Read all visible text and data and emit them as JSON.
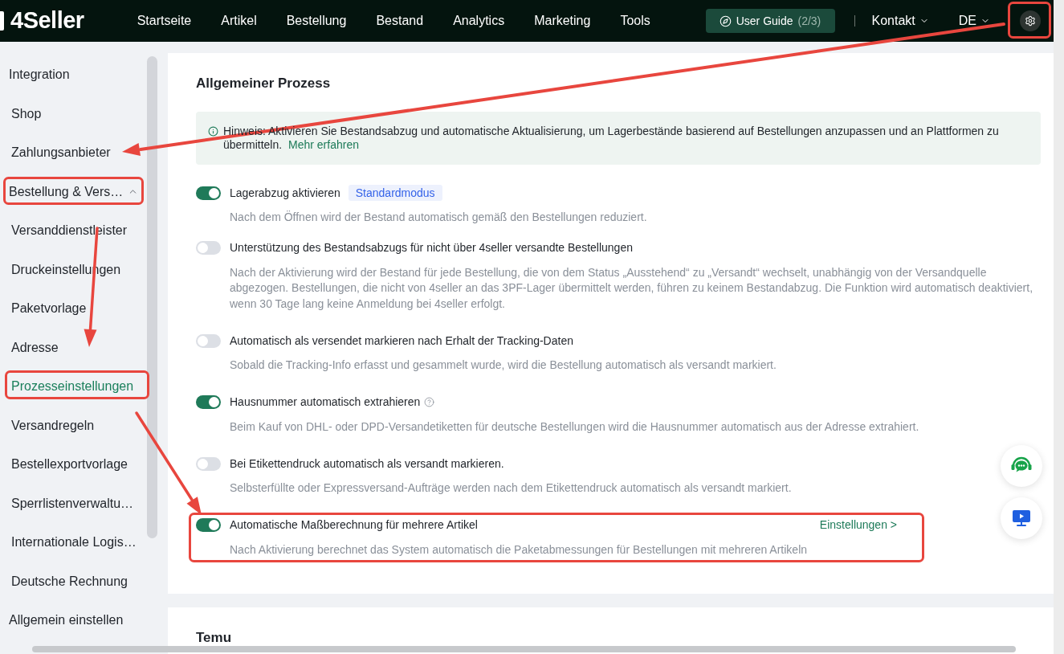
{
  "top_nav": {
    "logo": "4Seller",
    "items": [
      "Startseite",
      "Artikel",
      "Bestellung",
      "Bestand",
      "Analytics",
      "Marketing",
      "Tools"
    ],
    "user_guide": {
      "label": "User Guide",
      "progress": "(2/3)"
    },
    "contact": "Kontakt",
    "language": "DE"
  },
  "sidebar": {
    "items": [
      {
        "label": "Integration",
        "selected": false,
        "children": [
          {
            "label": "Shop",
            "selected": false
          },
          {
            "label": "Zahlungsanbieter",
            "selected": false
          }
        ]
      },
      {
        "label": "Bestellung & Vers…",
        "selected": false,
        "expanded": true,
        "children": [
          {
            "label": "Versanddienstleister",
            "selected": false
          },
          {
            "label": "Druckeinstellungen",
            "selected": false
          },
          {
            "label": "Paketvorlage",
            "selected": false
          },
          {
            "label": "Adresse",
            "selected": false
          },
          {
            "label": "Prozesseinstellungen",
            "selected": true
          },
          {
            "label": "Versandregeln",
            "selected": false
          },
          {
            "label": "Bestellexportvorlage",
            "selected": false
          },
          {
            "label": "Sperrlistenverwaltu…",
            "selected": false
          },
          {
            "label": "Internationale Logis…",
            "selected": false
          },
          {
            "label": "Deutsche Rechnung",
            "selected": false
          }
        ]
      },
      {
        "label": "Allgemein einstellen",
        "selected": false
      }
    ]
  },
  "sections": [
    {
      "title": "Allgemeiner Prozess",
      "notice": {
        "text": "Hinweis: Aktivieren Sie Bestandsabzug und automatische Aktualisierung, um Lagerbestände basierend auf Bestellungen anzupassen und an Plattformen zu übermitteln.",
        "link": "Mehr erfahren"
      },
      "settings": [
        {
          "label": "Lagerabzug aktivieren",
          "on": true,
          "badge": "Standardmodus",
          "help_icon": false,
          "description": "Nach dem Öffnen wird der Bestand automatisch gemäß den Bestellungen reduziert."
        },
        {
          "label": "Unterstützung des Bestandsabzugs für nicht über 4seller versandte Bestellungen",
          "on": false,
          "help_icon": false,
          "description": "Nach der Aktivierung wird der Bestand für jede Bestellung, die von dem Status „Ausstehend“ zu „Versandt“ wechselt, unabhängig von der Versandquelle abgezogen. Bestellungen, die nicht von 4seller an das 3PF-Lager übermittelt werden, führen zu keinem Bestandabzug. Die Funktion wird automatisch deaktiviert, wenn 30 Tage lang keine Anmeldung bei 4seller erfolgt."
        },
        {
          "label": "Automatisch als versendet markieren nach Erhalt der Tracking-Daten",
          "on": false,
          "help_icon": false,
          "description": "Sobald die Tracking-Info erfasst und gesammelt wurde, wird die Bestellung automatisch als versandt markiert."
        },
        {
          "label": "Hausnummer automatisch extrahieren",
          "on": true,
          "help_icon": true,
          "description": "Beim Kauf von DHL- oder DPD-Versandetiketten für deutsche Bestellungen wird die Hausnummer automatisch aus der Adresse extrahiert."
        },
        {
          "label": "Bei Etikettendruck automatisch als versandt markieren.",
          "on": false,
          "help_icon": false,
          "description": "Selbsterfüllte oder Expressversand-Aufträge werden nach dem Etikettendruck automatisch als versandt markiert."
        },
        {
          "label": "Automatische Maßberechnung für mehrere Artikel",
          "on": true,
          "help_icon": false,
          "link": "Einstellungen >",
          "description": "Nach Aktivierung berechnet das System automatisch die Paketabmessungen für Bestellungen mit mehreren Artikeln"
        }
      ]
    },
    {
      "title": "Temu"
    }
  ]
}
